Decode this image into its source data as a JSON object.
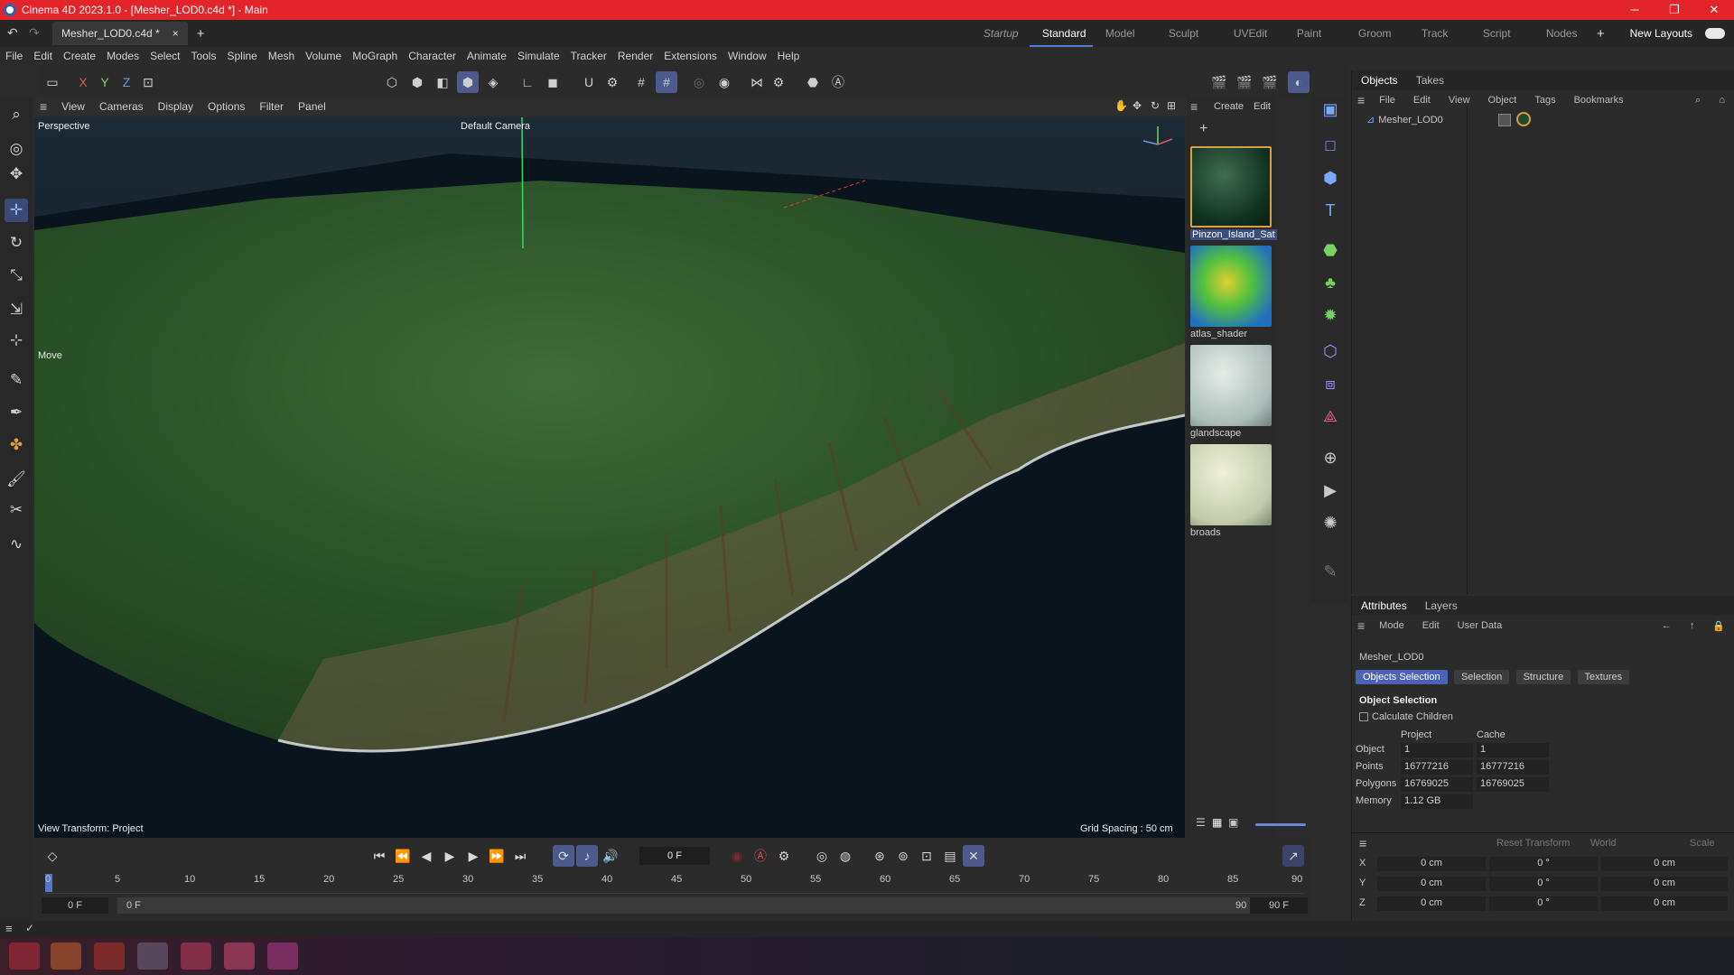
{
  "window": {
    "title": "Cinema 4D 2023.1.0 - [Mesher_LOD0.c4d *] - Main",
    "min": "─",
    "max": "❐",
    "close": "✕"
  },
  "doc_tab": {
    "label": "Mesher_LOD0.c4d *",
    "close": "×",
    "add": "+"
  },
  "layouts": [
    "Startup",
    "Standard",
    "Model",
    "Sculpt",
    "UVEdit",
    "Paint",
    "Groom",
    "Track",
    "Script",
    "Nodes"
  ],
  "layouts_extra": {
    "plus": "+",
    "new_layouts": "New Layouts"
  },
  "menu": [
    "File",
    "Edit",
    "Create",
    "Modes",
    "Select",
    "Tools",
    "Spline",
    "Mesh",
    "Volume",
    "MoGraph",
    "Character",
    "Animate",
    "Simulate",
    "Tracker",
    "Render",
    "Extensions",
    "Window",
    "Help"
  ],
  "axis_toggles": {
    "x": "X",
    "y": "Y",
    "z": "Z"
  },
  "viewport_menu": [
    "View",
    "Cameras",
    "Display",
    "Options",
    "Filter",
    "Panel"
  ],
  "viewport": {
    "name": "Perspective",
    "camera": "Default Camera",
    "tool": "Move",
    "view_transform": "View Transform: Project",
    "grid_spacing": "Grid Spacing : 50 cm"
  },
  "material_menu": {
    "create": "Create",
    "edit": "Edit"
  },
  "materials": [
    {
      "name": "Pinzon_Island_Sat"
    },
    {
      "name": "atlas_shader"
    },
    {
      "name": "glandscape"
    },
    {
      "name": "broads"
    }
  ],
  "objects": {
    "tabs": [
      "Objects",
      "Takes"
    ],
    "menu": [
      "File",
      "Edit",
      "View",
      "Object",
      "Tags",
      "Bookmarks"
    ],
    "items": [
      {
        "name": "Mesher_LOD0"
      }
    ]
  },
  "attributes": {
    "tabs": [
      "Attributes",
      "Layers"
    ],
    "menu": [
      "Mode",
      "Edit",
      "User Data"
    ],
    "object_name": "Mesher_LOD0",
    "buttons": [
      "Objects Selection",
      "Selection",
      "Structure",
      "Textures"
    ],
    "section": "Object Selection",
    "calc_children": "Calculate Children",
    "col_project": "Project",
    "col_cache": "Cache",
    "rows": [
      {
        "label": "Object",
        "project": "1",
        "cache": "1"
      },
      {
        "label": "Points",
        "project": "16777216",
        "cache": "16777216"
      },
      {
        "label": "Polygons",
        "project": "16769025",
        "cache": "16769025"
      },
      {
        "label": "Memory",
        "project": "1.12 GB",
        "cache": ""
      }
    ]
  },
  "coords": {
    "reset": "Reset Transform",
    "space": "World",
    "mode": "Scale",
    "rows": [
      {
        "axis": "X",
        "pos": "0 cm",
        "rot": "0 °",
        "scale": "0 cm"
      },
      {
        "axis": "Y",
        "pos": "0 cm",
        "rot": "0 °",
        "scale": "0 cm"
      },
      {
        "axis": "Z",
        "pos": "0 cm",
        "rot": "0 °",
        "scale": "0 cm"
      }
    ]
  },
  "timeline": {
    "current_frame": "0 F",
    "ticks": [
      "0",
      "5",
      "10",
      "15",
      "20",
      "25",
      "30",
      "35",
      "40",
      "45",
      "50",
      "55",
      "60",
      "65",
      "70",
      "75",
      "80",
      "85",
      "90"
    ],
    "start": "0 F",
    "range_start": "0 F",
    "range_end": "90 F",
    "end": "90 F"
  }
}
